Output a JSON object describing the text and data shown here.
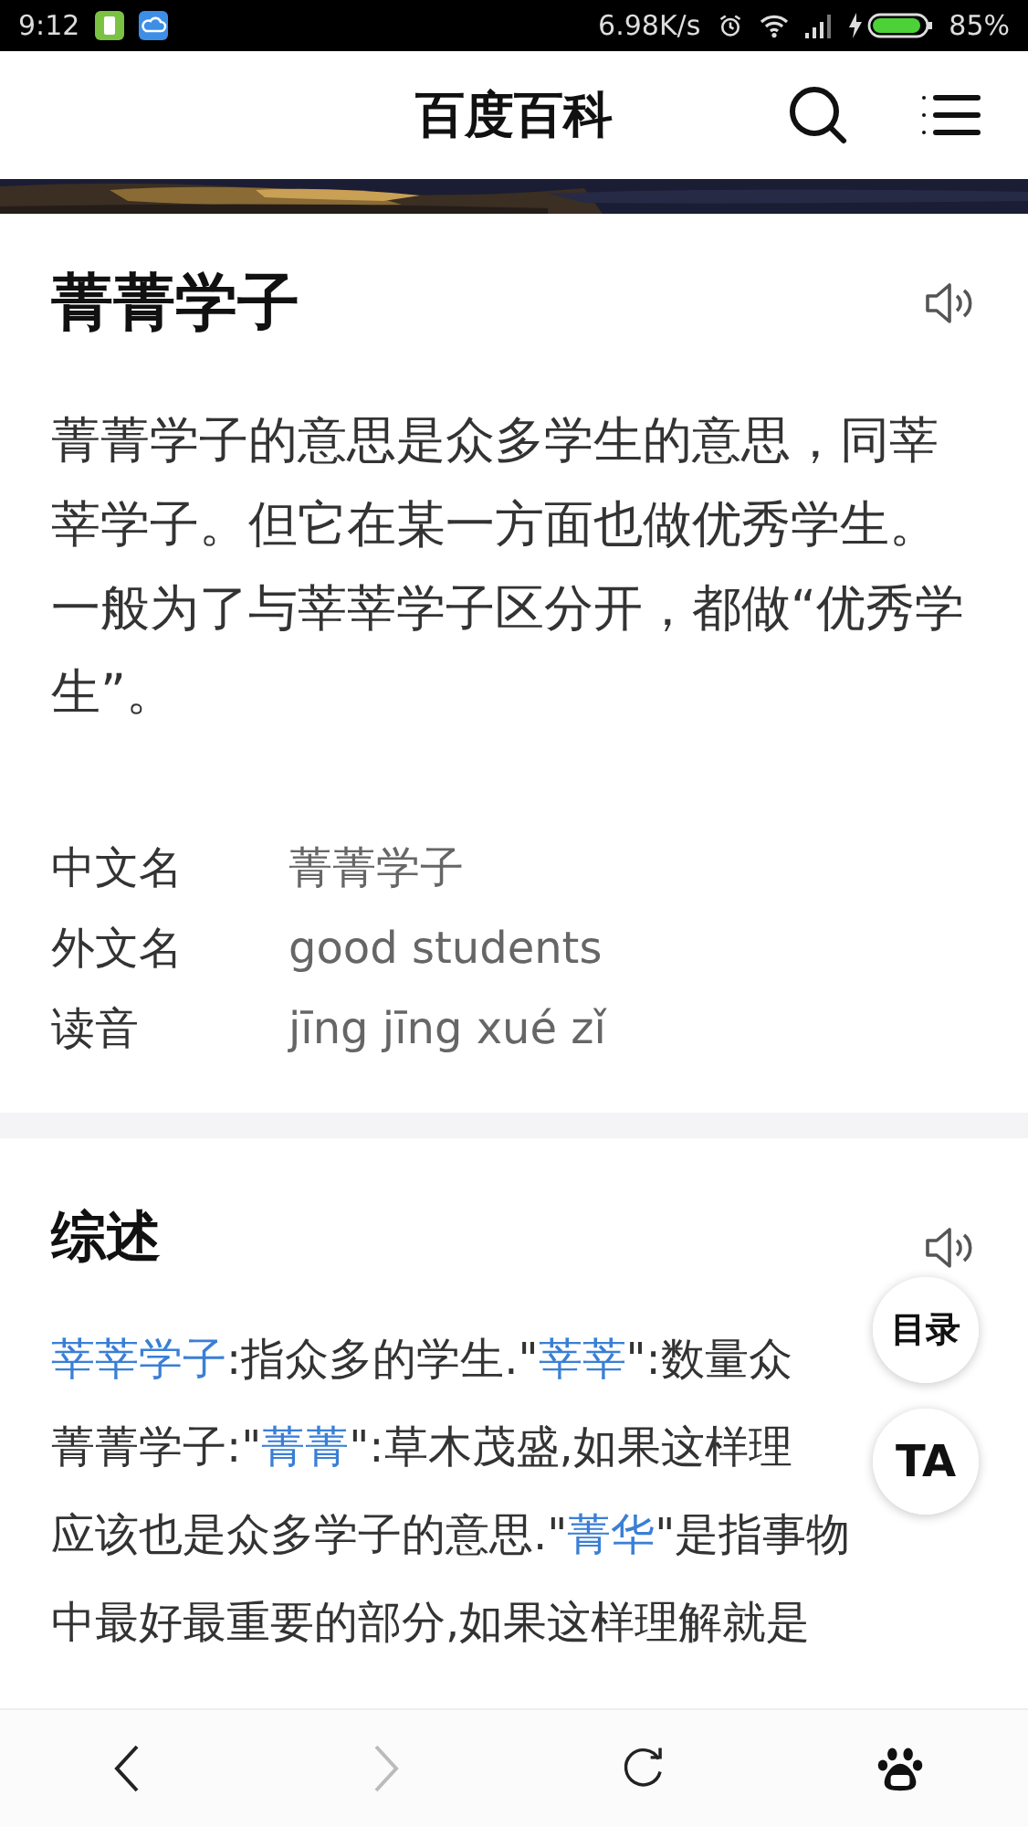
{
  "status_bar": {
    "time": "9:12",
    "speed": "6.98K/s",
    "battery": "85%"
  },
  "header": {
    "title": "百度百科"
  },
  "entry": {
    "title": "菁菁学子",
    "summary": "菁菁学子的意思是众多学生的意思，同莘莘学子。但它在某一方面也做优秀学生。一般为了与莘莘学子区分开，都做“优秀学生”。",
    "info": [
      {
        "label": "中文名",
        "value": "菁菁学子"
      },
      {
        "label": "外文名",
        "value": "good students"
      },
      {
        "label": "读音",
        "value": "jīng jīng xué zǐ"
      }
    ]
  },
  "section": {
    "title": "综述",
    "lines": [
      [
        {
          "text": "莘莘学子",
          "kind": "link"
        },
        {
          "text": ":指众多的学生.\"",
          "kind": "text"
        },
        {
          "text": "莘莘",
          "kind": "link"
        },
        {
          "text": "\":数量众",
          "kind": "text"
        }
      ],
      [
        {
          "text": "菁菁学子:\"",
          "kind": "text"
        },
        {
          "text": "菁菁",
          "kind": "link"
        },
        {
          "text": "\":草木茂盛,如果这样理",
          "kind": "text"
        }
      ],
      [
        {
          "text": "应该也是众多学子的意思.\"",
          "kind": "text"
        },
        {
          "text": "菁华",
          "kind": "link"
        },
        {
          "text": "\"是指事物",
          "kind": "text"
        }
      ],
      [
        {
          "text": "中最好最重要的部分,如果这样理解就是",
          "kind": "text"
        }
      ]
    ]
  },
  "floating": [
    {
      "label": "目录"
    },
    {
      "label": "TA"
    }
  ],
  "nav": [
    {
      "kind": "back",
      "disabled": false
    },
    {
      "kind": "forward",
      "disabled": true
    },
    {
      "kind": "refresh",
      "disabled": false
    },
    {
      "kind": "paw",
      "disabled": false
    }
  ]
}
